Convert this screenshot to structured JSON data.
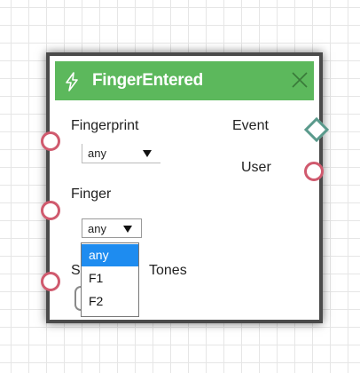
{
  "node": {
    "title": "FingerEntered",
    "header_color": "#5cb85c",
    "icon": "lightning-bolt-icon",
    "close_icon": "close-icon"
  },
  "inputs": {
    "fingerprint": {
      "label": "Fingerprint",
      "value": "any"
    },
    "finger": {
      "label": "Finger",
      "value": "any"
    },
    "third": {
      "label_visible_start": "S",
      "label_visible_end": "Tones"
    }
  },
  "outputs": {
    "event": {
      "label": "Event"
    },
    "user": {
      "label": "User"
    }
  },
  "finger_dropdown": {
    "options": [
      "any",
      "F1",
      "F2"
    ],
    "selected": "any"
  },
  "colors": {
    "input_port": "#d05a6e",
    "event_port": "#5a9a8c",
    "selection": "#1e8cf0"
  }
}
